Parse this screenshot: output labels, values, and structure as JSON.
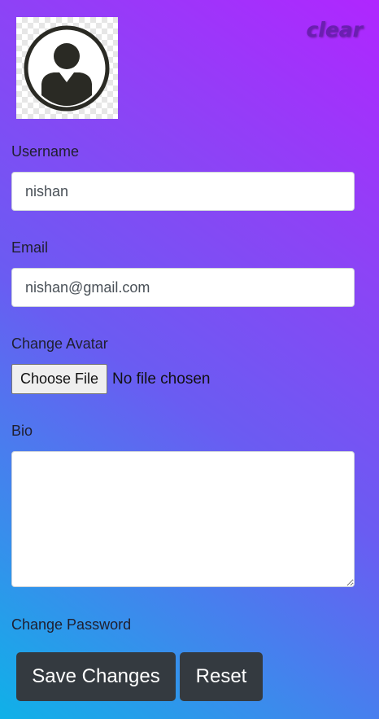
{
  "header": {
    "avatar_alt": "user avatar",
    "clear_label": "clear"
  },
  "form": {
    "username": {
      "label": "Username",
      "value": "nishan"
    },
    "email": {
      "label": "Email",
      "value": "nishan@gmail.com"
    },
    "avatar_upload": {
      "label": "Change Avatar",
      "button_label": "Choose File",
      "status": "No file chosen"
    },
    "bio": {
      "label": "Bio",
      "value": ""
    },
    "password": {
      "label": "Change Password"
    }
  },
  "actions": {
    "save_label": "Save Changes",
    "reset_label": "Reset"
  },
  "colors": {
    "gradient_top": "#b026ff",
    "gradient_bottom": "#0fb1e8",
    "button_bg": "#343a40",
    "clear_text": "#6a1fb0"
  },
  "icons": {
    "avatar": "user-silhouette-icon"
  }
}
